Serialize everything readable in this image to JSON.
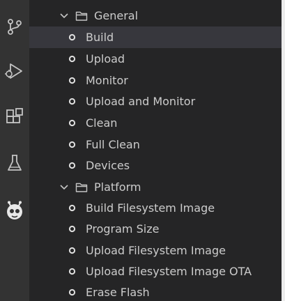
{
  "activity_bar": {
    "icons": [
      "source-control-icon",
      "run-debug-icon",
      "extensions-icon",
      "testing-icon",
      "platformio-icon"
    ]
  },
  "tree": {
    "groups": [
      {
        "label": "General",
        "expanded": true,
        "items": [
          {
            "label": "Build",
            "selected": true
          },
          {
            "label": "Upload"
          },
          {
            "label": "Monitor"
          },
          {
            "label": "Upload and Monitor"
          },
          {
            "label": "Clean"
          },
          {
            "label": "Full Clean"
          },
          {
            "label": "Devices"
          }
        ]
      },
      {
        "label": "Platform",
        "expanded": true,
        "items": [
          {
            "label": "Build Filesystem Image"
          },
          {
            "label": "Program Size"
          },
          {
            "label": "Upload Filesystem Image"
          },
          {
            "label": "Upload Filesystem Image OTA"
          },
          {
            "label": "Erase Flash"
          }
        ]
      }
    ]
  },
  "colors": {
    "panel_bg": "#252526",
    "activity_bg": "#333333",
    "selected_bg": "#37373d",
    "text": "#cccccc",
    "icon": "#c5c5c5"
  }
}
